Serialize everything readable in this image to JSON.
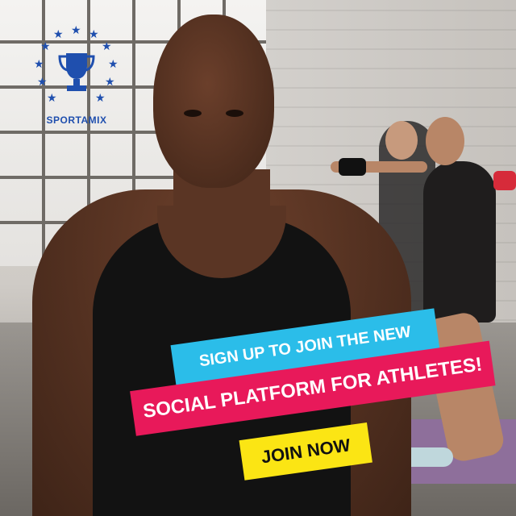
{
  "brand": {
    "name": "SPORTAMIX",
    "logo_icon": "trophy-with-stars-icon",
    "color": "#1f4fae"
  },
  "headline": {
    "line1": "SIGN UP TO JOIN THE NEW",
    "line2": "SOCIAL PLATFORM FOR ATHLETES!"
  },
  "cta": {
    "label": "JOIN NOW"
  },
  "colors": {
    "banner1": "#2bbde9",
    "banner2": "#e8195a",
    "cta": "#fbe514"
  }
}
